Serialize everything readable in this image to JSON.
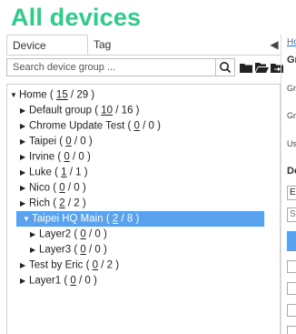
{
  "page_title": "All devices",
  "tabs": [
    {
      "label": "Device groups",
      "active": true
    },
    {
      "label": "Tag",
      "active": false
    }
  ],
  "search": {
    "placeholder": "Search device group ..."
  },
  "tree": [
    {
      "name": "Home",
      "a": "15",
      "b": "29",
      "level": 0,
      "expanded": true
    },
    {
      "name": "Default group",
      "a": "10",
      "b": "16",
      "level": 1,
      "expanded": false
    },
    {
      "name": "Chrome Update Test",
      "a": "0",
      "b": "0",
      "level": 1,
      "expanded": false
    },
    {
      "name": "Taipei",
      "a": "0",
      "b": "0",
      "level": 1,
      "expanded": false
    },
    {
      "name": "Irvine",
      "a": "0",
      "b": "0",
      "level": 1,
      "expanded": false
    },
    {
      "name": "Luke",
      "a": "1",
      "b": "1",
      "level": 1,
      "expanded": false
    },
    {
      "name": "Nico",
      "a": "0",
      "b": "0",
      "level": 1,
      "expanded": false
    },
    {
      "name": "Rich",
      "a": "2",
      "b": "2",
      "level": 1,
      "expanded": false
    },
    {
      "name": "Taipei HQ Main",
      "a": "2",
      "b": "8",
      "level": 1,
      "expanded": true,
      "selected": true
    },
    {
      "name": "Layer2",
      "a": "0",
      "b": "0",
      "level": 2,
      "expanded": false
    },
    {
      "name": "Layer3",
      "a": "0",
      "b": "0",
      "level": 2,
      "expanded": false
    },
    {
      "name": "Test by Eric",
      "a": "0",
      "b": "2",
      "level": 1,
      "expanded": false
    },
    {
      "name": "Layer1",
      "a": "0",
      "b": "0",
      "level": 1,
      "expanded": false
    }
  ],
  "right_panel": {
    "link": "Ho",
    "heading1": "Gr",
    "row1": "Gr",
    "row2": "Gr",
    "row3": "Us",
    "heading2": "De",
    "box1": "E",
    "box2": "S"
  },
  "colors": {
    "title": "#2ecc8a",
    "selection": "#5aa2ee",
    "link": "#3a75c4"
  }
}
